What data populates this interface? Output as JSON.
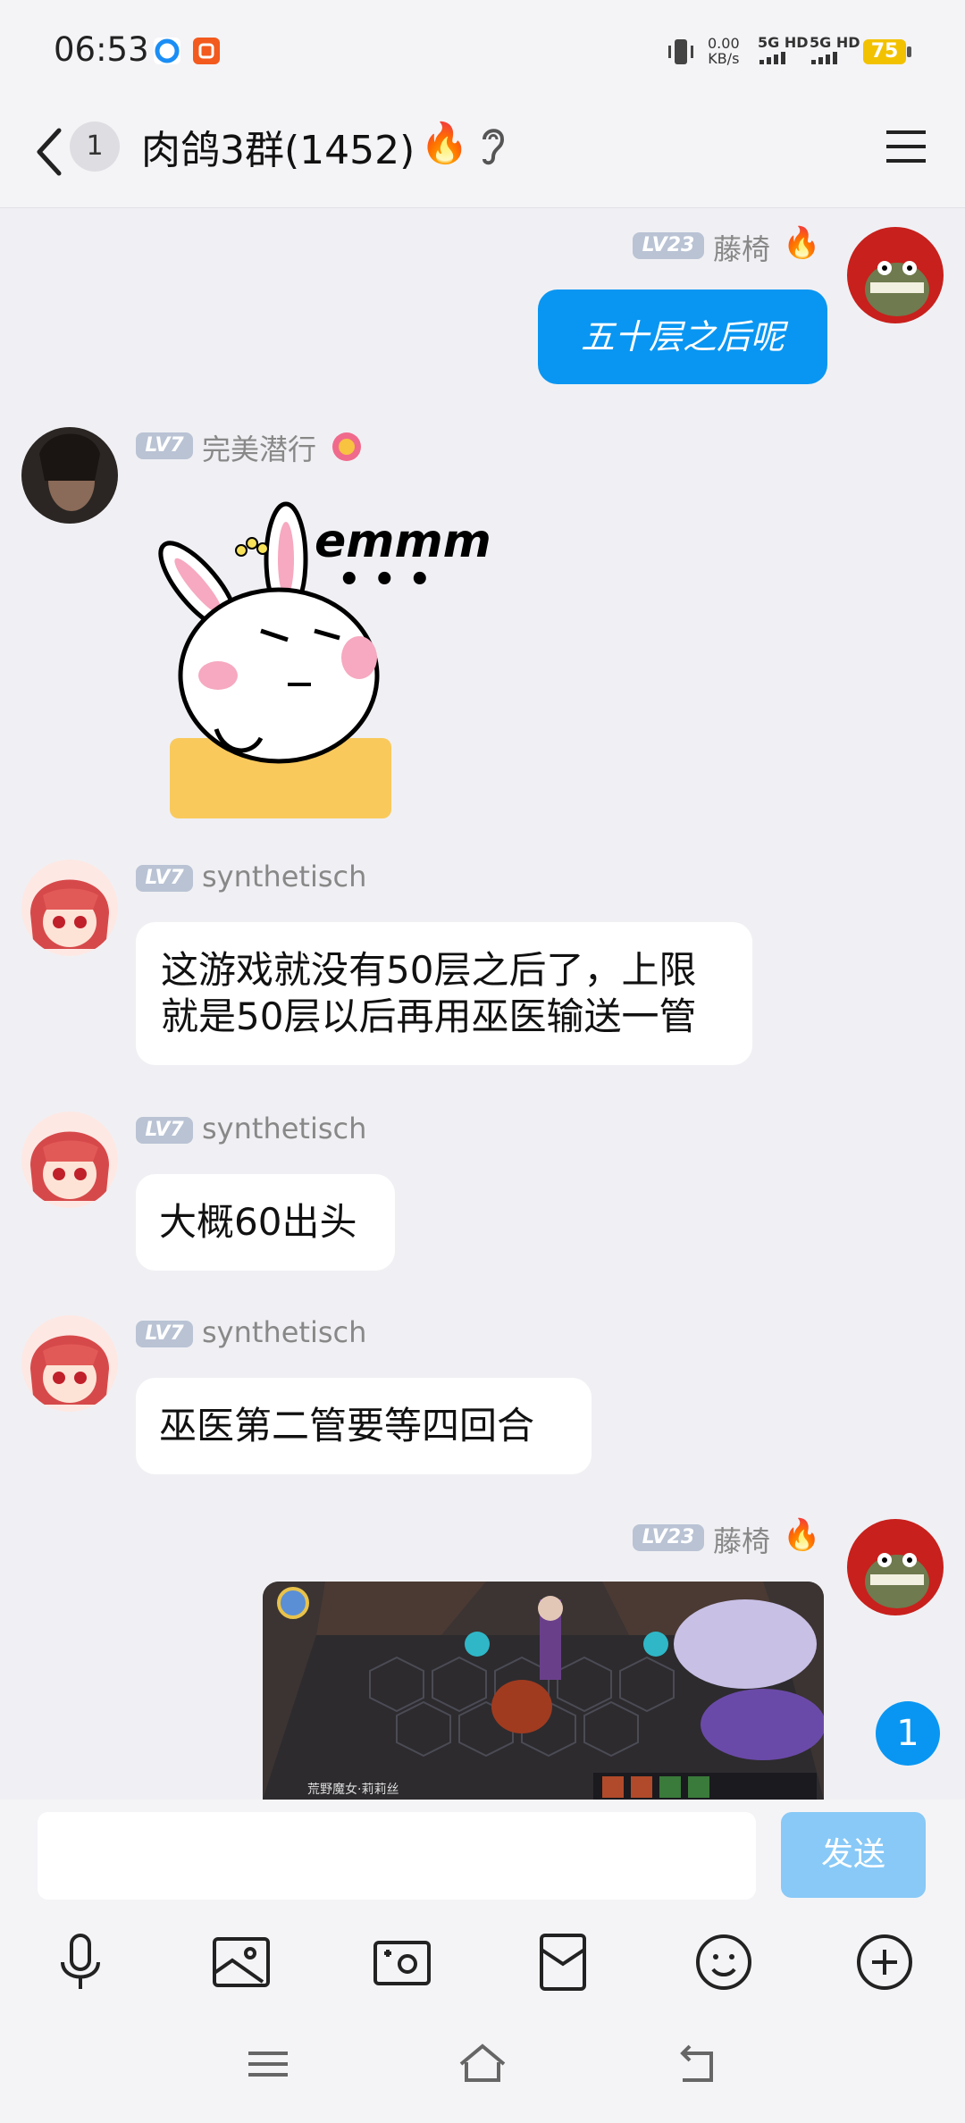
{
  "status_bar": {
    "time": "06:53",
    "net_speed_value": "0.00",
    "net_speed_unit": "KB/s",
    "signal_1": "5G HD",
    "signal_2": "5G HD",
    "battery": "75"
  },
  "header": {
    "unread_count": "1",
    "title": "肉鸽3群(1452)"
  },
  "messages": [
    {
      "side": "right",
      "level": "LV23",
      "sender": "藤椅",
      "text": "五十层之后呢"
    },
    {
      "side": "left",
      "level": "LV7",
      "sender": "完美潜行",
      "sticker_text": "emmm",
      "sticker_dots": "• • •"
    },
    {
      "side": "left",
      "level": "LV7",
      "sender": "synthetisch",
      "text": "这游戏就没有50层之后了，上限就是50层以后再用巫医输送一管"
    },
    {
      "side": "left",
      "level": "LV7",
      "sender": "synthetisch",
      "text": "大概60出头"
    },
    {
      "side": "left",
      "level": "LV7",
      "sender": "synthetisch",
      "text": "巫医第二管要等四回合"
    },
    {
      "side": "right",
      "level": "LV23",
      "sender": "藤椅",
      "image": "game-screenshot",
      "image_caption": "荒野魔女·莉莉丝"
    }
  ],
  "new_message_badge": "1",
  "composer": {
    "input_value": "",
    "send_label": "发送"
  },
  "colors": {
    "accent": "#0996f2",
    "background": "#f0f0f4",
    "send_disabled": "#88c9f7"
  },
  "toolbar_icons": [
    "microphone-icon",
    "image-icon",
    "camera-icon",
    "red-packet-icon",
    "emoji-icon",
    "plus-icon"
  ],
  "nav_icons": [
    "menu-nav-icon",
    "home-nav-icon",
    "back-nav-icon"
  ]
}
